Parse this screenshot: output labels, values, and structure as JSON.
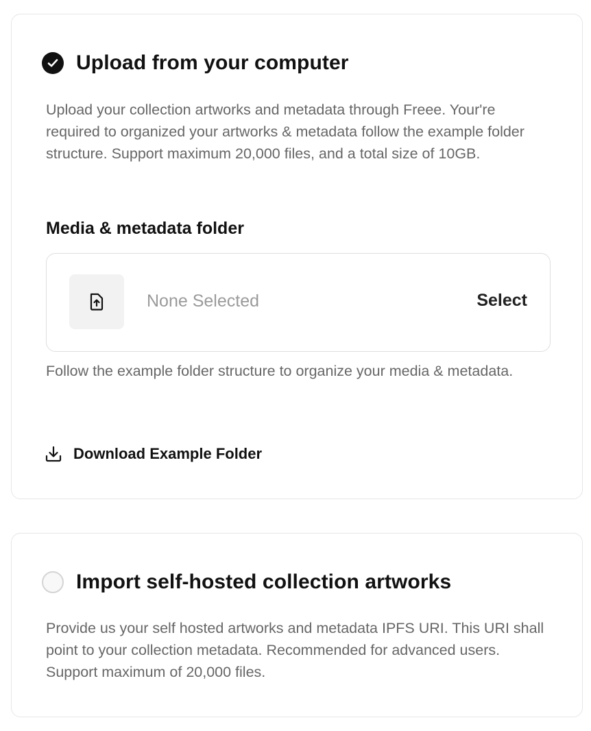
{
  "upload_option": {
    "title": "Upload from your computer",
    "selected": true,
    "description": "Upload your collection artworks and metadata through Freee. Your're required to organized your artworks & metadata follow the example folder structure. Support maximum 20,000 files, and a total size of 10GB.",
    "folder_label": "Media & metadata folder",
    "folder_value": "None Selected",
    "select_label": "Select",
    "helper_text": "Follow the example folder structure to organize your media & metadata.",
    "download_label": "Download Example Folder",
    "icons": {
      "radio": "checkmark-circle-icon",
      "file": "file-upload-icon",
      "download": "download-icon"
    }
  },
  "import_option": {
    "title": "Import self-hosted collection artworks",
    "selected": false,
    "description": "Provide us your self hosted artworks and metadata IPFS URI. This URI shall point to your collection metadata. Recommended for advanced users. Support maximum of 20,000 files."
  },
  "colors": {
    "text_primary": "#111111",
    "text_secondary": "#666666",
    "placeholder": "#9a9a9a",
    "border": "#e6e6e6",
    "icon_box_bg": "#f2f2f2"
  }
}
